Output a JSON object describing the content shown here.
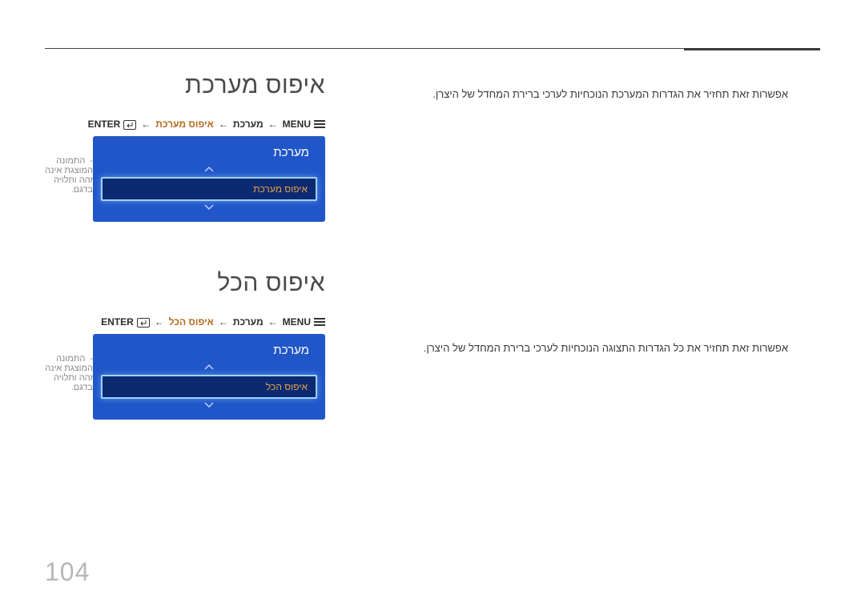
{
  "page_number": "104",
  "sections": [
    {
      "heading": "איפוס מערכת",
      "breadcrumb": {
        "menu_label": "MENU",
        "part1": "מערכת",
        "highlight": "איפוס מערכת",
        "enter_label": "ENTER"
      },
      "osd": {
        "title": "מערכת",
        "item": "איפוס מערכת"
      },
      "note": "התמונה המוצגת אינה זהה ותלויה בדגם.",
      "description": "אפשרות זאת תחזיר את הגדרות המערכת הנוכחיות לערכי ברירת המחדל של היצרן."
    },
    {
      "heading": "איפוס הכל",
      "breadcrumb": {
        "menu_label": "MENU",
        "part1": "מערכת",
        "highlight": "איפוס הכל",
        "enter_label": "ENTER"
      },
      "osd": {
        "title": "מערכת",
        "item": "איפוס הכל"
      },
      "note": "התמונה המוצגת אינה זהה ותלויה בדגם.",
      "description": "אפשרות זאת תחזיר את כל הגדרות התצוגה הנוכחיות לערכי ברירת המחדל של היצרן."
    }
  ],
  "icons": {
    "arrow": "←"
  }
}
